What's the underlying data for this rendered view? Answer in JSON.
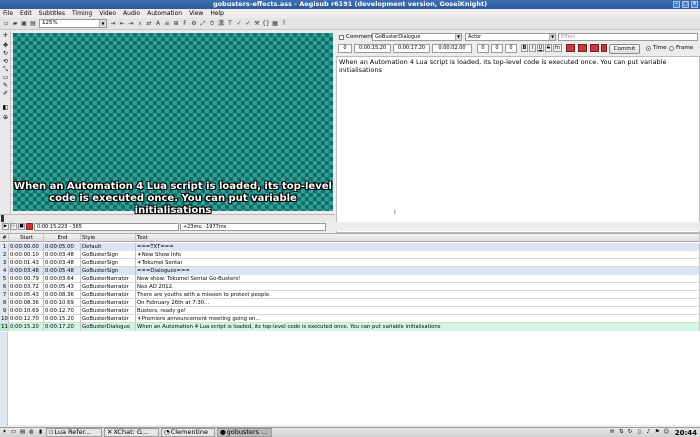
{
  "window": {
    "title": "gobusters-effects.ass - Aegisub r6191 (development version, GoseiKnight)"
  },
  "menu": [
    "File",
    "Edit",
    "Subtitles",
    "Timing",
    "Video",
    "Audio",
    "Automation",
    "View",
    "Help"
  ],
  "toolbar": {
    "zoom": "125%"
  },
  "video": {
    "subtitle_line1": "When an Automation 4 Lua script is loaded, its top-level",
    "subtitle_line2": "code is executed once. You can put variable initialisations",
    "time_display": "0:00:15.223 - 365",
    "offset_display": "+23ms; -1977ms"
  },
  "edit": {
    "comment_label": "Comment",
    "style": "GoBusterDialogue",
    "actor": "Actor",
    "effect_placeholder": "Effect",
    "layer": "0",
    "start_time": "0:00:15.20",
    "end_time": "0:00:17.20",
    "duration": "0:00:02.00",
    "margin_l": "0",
    "margin_r": "0",
    "margin_v": "0",
    "bold": "B",
    "italic": "I",
    "underline": "U",
    "strike": "S",
    "font": "fn",
    "commit": "Commit",
    "time_label": "Time",
    "frame_label": "Frame",
    "text": "When an Automation 4 Lua script is loaded, its top-level code is executed once. You can put variable initialisations"
  },
  "grid": {
    "headers": {
      "num": "#",
      "start": "Start",
      "end": "End",
      "style": "Style",
      "text": "Text"
    },
    "rows": [
      {
        "num": "1",
        "start": "0:00:00.00",
        "end": "0:00:05.00",
        "style": "Default",
        "text": "===TXT===",
        "kind": "comment"
      },
      {
        "num": "2",
        "start": "0:00:00.10",
        "end": "0:00:03.48",
        "style": "GoBusterSign",
        "text": "☀New Show Info",
        "kind": ""
      },
      {
        "num": "3",
        "start": "0:00:01.43",
        "end": "0:00:03.48",
        "style": "GoBusterSign",
        "text": "☀Tokumei Sentai",
        "kind": ""
      },
      {
        "num": "4",
        "start": "0:00:03.48",
        "end": "0:00:05.48",
        "style": "GoBusterSign",
        "text": "===Dialogues===",
        "kind": "comment"
      },
      {
        "num": "5",
        "start": "0:00:00.79",
        "end": "0:00:03.64",
        "style": "GoBusterNarrator",
        "text": "New show: Tokumei Sentai Go-Busters!",
        "kind": ""
      },
      {
        "num": "6",
        "start": "0:00:03.72",
        "end": "0:00:05.43",
        "style": "GoBusterNarrator",
        "text": "Neo AD 2012.",
        "kind": ""
      },
      {
        "num": "7",
        "start": "0:00:05.43",
        "end": "0:00:08.36",
        "style": "GoBusterNarrator",
        "text": "There are youths with a mission to protect people.",
        "kind": ""
      },
      {
        "num": "8",
        "start": "0:00:08.36",
        "end": "0:00:10.69",
        "style": "GoBusterNarrator",
        "text": "On February 26th at 7:30...",
        "kind": ""
      },
      {
        "num": "9",
        "start": "0:00:10.69",
        "end": "0:00:12.70",
        "style": "GoBusterNarrator",
        "text": "Busters, ready go!",
        "kind": ""
      },
      {
        "num": "10",
        "start": "0:00:12.70",
        "end": "0:00:15.20",
        "style": "GoBusterNarrator",
        "text": "☀Premiere announcement meeting going on...",
        "kind": ""
      },
      {
        "num": "11",
        "start": "0:00:15.20",
        "end": "0:00:17.20",
        "style": "GoBusterDialogue",
        "text": "When an Automation 4 Lua script is loaded, its top-level code is executed once. You can put variable initialisations",
        "kind": "active"
      }
    ]
  },
  "taskbar": {
    "tasks": [
      "Lua Refer...",
      "XChat: G...",
      "Clementine",
      "gobusters ..."
    ],
    "clock": "20:44"
  }
}
